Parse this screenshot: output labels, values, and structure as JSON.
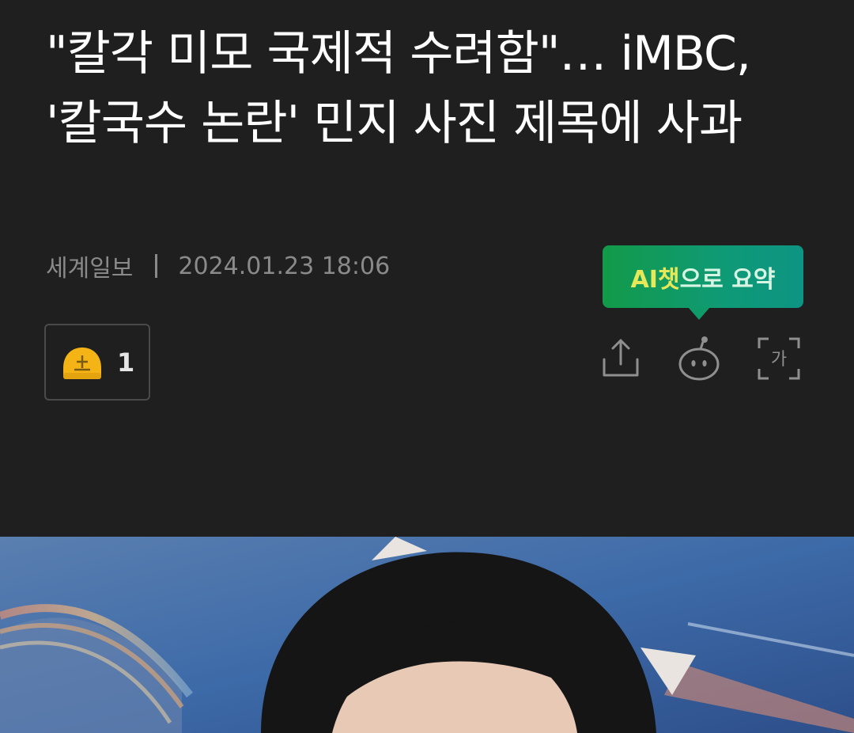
{
  "article": {
    "title": "\"칼각 미모 국제적 수려함\"… iMBC, '칼국수 논란' 민지 사진 제목에 사과",
    "source": "세계일보",
    "datetime": "2024.01.23 18:06"
  },
  "reaction": {
    "icon": "smiley-helmet-icon",
    "count": "1"
  },
  "ai_summary": {
    "label_highlight": "AI챗",
    "label_rest": "으로 요약"
  },
  "actions": [
    {
      "icon": "share-icon"
    },
    {
      "icon": "ai-chat-bot-icon"
    },
    {
      "icon": "font-size-icon",
      "glyph": "가"
    }
  ],
  "colors": {
    "background": "#1f1f1f",
    "title": "#ffffff",
    "meta": "#8a8a8a",
    "ai_bubble": "#129a49",
    "ai_highlight": "#e6e85a",
    "reaction_icon": "#f5b415"
  }
}
